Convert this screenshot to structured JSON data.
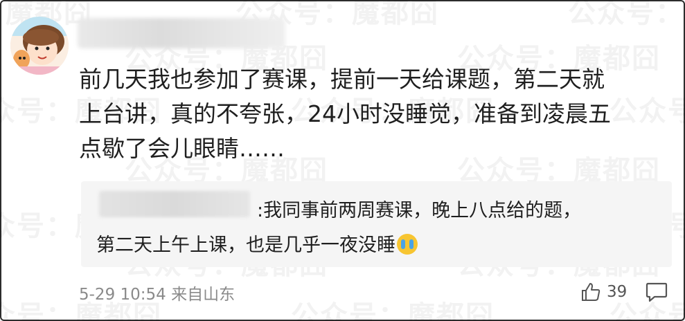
{
  "watermark": "公众号：魔都囧",
  "comment": {
    "lines": [
      "前几天我也参加了赛课，提前一天给课题，第二天就",
      "上台讲，真的不夸张，24小时没睡觉，准备到凌晨五",
      "点歇了会儿眼睛……"
    ]
  },
  "reply": {
    "line1": ":我同事前两周赛课，晚上八点给的题，",
    "line2": "第二天上午上课，也是几乎一夜没睡"
  },
  "meta": {
    "timestamp": "5-29 10:54",
    "location": "来自山东"
  },
  "actions": {
    "like_count": "39",
    "like_icon": "thumbs-up-icon",
    "comment_icon": "comment-bubble-icon"
  },
  "colors": {
    "border": "#2c2c2c",
    "reply_bg": "#f5f5f5",
    "meta_text": "#8a8a8a"
  }
}
